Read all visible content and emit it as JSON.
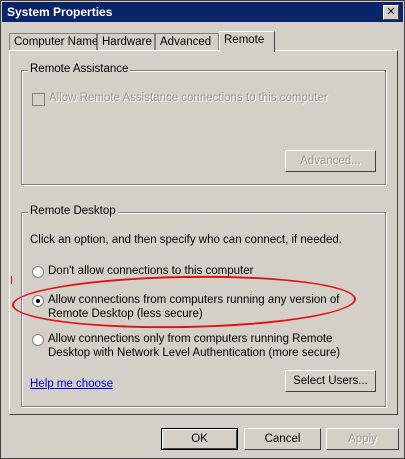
{
  "window": {
    "title": "System Properties",
    "close_glyph": "✕"
  },
  "tabs": [
    {
      "label": "Computer Name"
    },
    {
      "label": "Hardware"
    },
    {
      "label": "Advanced"
    },
    {
      "label": "Remote",
      "active": true
    }
  ],
  "remote_assistance": {
    "group_label": "Remote Assistance",
    "checkbox_label": "Allow Remote Assistance connections to this computer",
    "checked": false,
    "enabled": false,
    "advanced_button": "Advanced..."
  },
  "remote_desktop": {
    "group_label": "Remote Desktop",
    "instructions": "Click an option, and then specify who can connect, if needed.",
    "options": [
      {
        "line1": "Don't allow connections to this computer",
        "line2": "",
        "selected": false
      },
      {
        "line1": "Allow connections from computers running any version of",
        "line2": "Remote Desktop (less secure)",
        "selected": true
      },
      {
        "line1": "Allow connections only from computers running Remote",
        "line2": "Desktop with Network Level Authentication (more secure)",
        "selected": false
      }
    ],
    "help_link": "Help me choose",
    "select_users_button": "Select Users..."
  },
  "footer": {
    "ok": "OK",
    "cancel": "Cancel",
    "apply": "Apply"
  },
  "colors": {
    "highlight_oval": "#e21010",
    "title_bar": "#0a246a",
    "face": "#d4d0c8"
  }
}
